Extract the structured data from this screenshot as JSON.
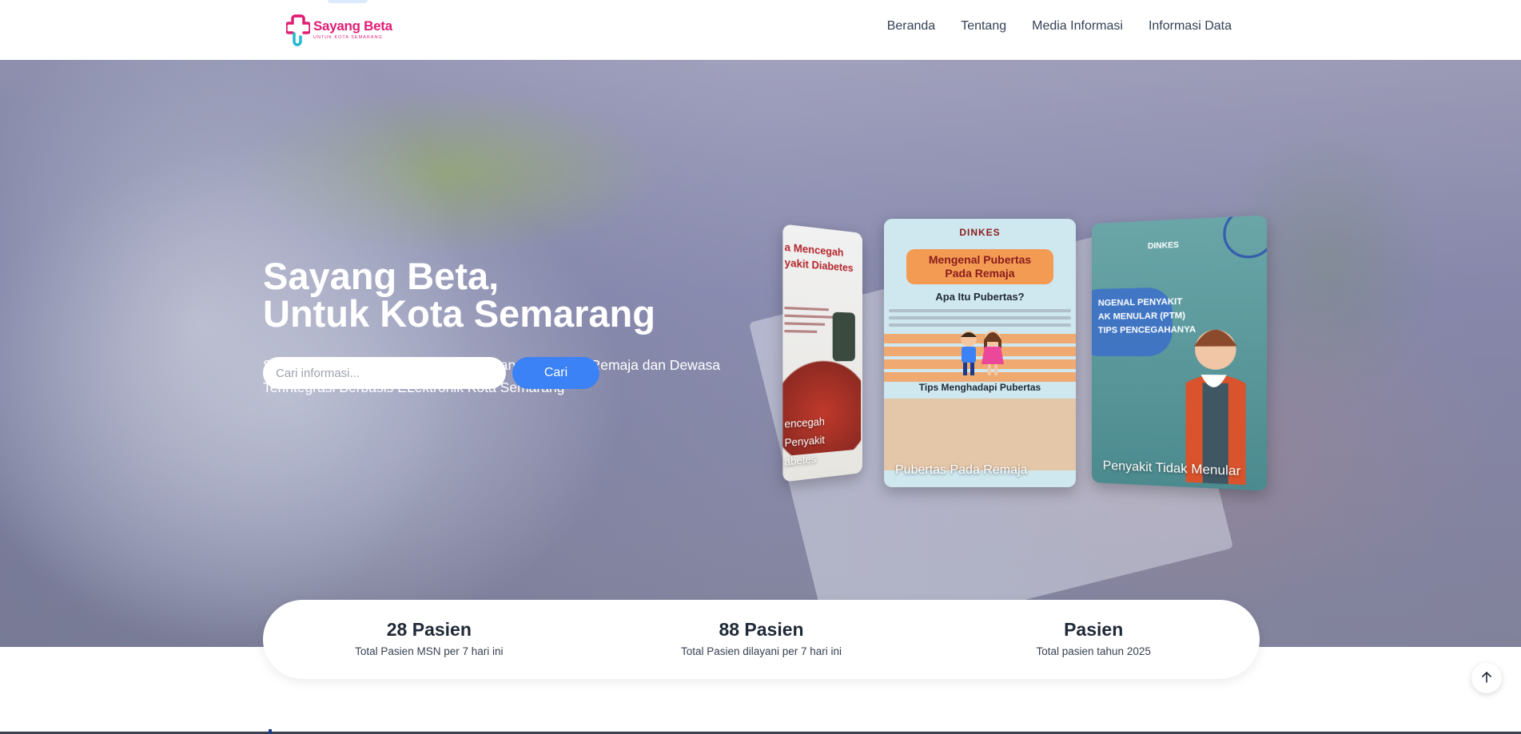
{
  "brand": {
    "title": "Sayang Beta",
    "subtitle": "UNTUK KOTA SEMARANG",
    "color": "#e11d74"
  },
  "nav": {
    "items": [
      "Beranda",
      "Tentang",
      "Media Informasi",
      "Informasi Data"
    ]
  },
  "hero": {
    "title_line1": "Sayang Beta,",
    "title_line2": "Untuk Kota Semarang",
    "subtitle": "Simplifikasi Layanan dan Pendampingan Kesehatan Remaja dan Dewasa Terintegrasi Berbasis ELektronik Kota Semarang"
  },
  "search": {
    "placeholder": "Cari informasi...",
    "button_label": "Cari",
    "accent": "#3b82f6"
  },
  "carousel": {
    "left": {
      "heading_line1": "a Mencegah",
      "heading_line2": "yakit Diabetes",
      "caption_line1": "encegah Penyakit",
      "caption_line2": "abetes"
    },
    "center": {
      "org": "DINKES",
      "banner_line1": "Mengenal Pubertas",
      "banner_line2": "Pada Remaja",
      "question": "Apa Itu Pubertas?",
      "tips": "Tips Menghadapi Pubertas",
      "caption": "Pubertas Pada Remaja"
    },
    "right": {
      "org": "DINKES",
      "title_line1": "NGENAL PENYAKIT",
      "title_line2": "AK MENULAR (PTM)",
      "title_line3": "TIPS PENCEGAHANYA",
      "caption": "Penyakit Tidak Menular"
    }
  },
  "stats": [
    {
      "value": "28 Pasien",
      "label": "Total Pasien MSN per 7 hari ini"
    },
    {
      "value": "88 Pasien",
      "label": "Total Pasien dilayani per 7 hari ini"
    },
    {
      "value": "Pasien",
      "label": "Total pasien tahun 2025"
    }
  ],
  "icons": {
    "back_to_top": "arrow-up-icon",
    "logo": "cross-heart-logo-icon"
  }
}
